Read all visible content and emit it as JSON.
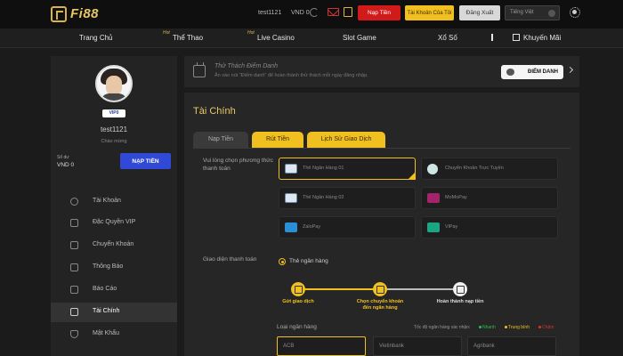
{
  "header": {
    "logo": "Fi88",
    "username": "test1121",
    "balance": "VND 0",
    "deposit_btn": "Nạp Tiền",
    "account_btn": "Tài Khoản Của Tôi",
    "logout_btn": "Đăng Xuất",
    "language": "Tiếng Việt",
    "lang_flag": "VN"
  },
  "nav": {
    "hot": "Hot",
    "items": [
      "Trang Chủ",
      "Thể Thao",
      "Live Casino",
      "Slot Game",
      "Xổ Số",
      "Khuyến Mãi"
    ]
  },
  "sidebar": {
    "vip": "VIP0",
    "username": "test1121",
    "welcome": "Chào mừng",
    "balance_label": "Số dư",
    "balance_value": "VND 0",
    "deposit_btn": "NẠP TIỀN",
    "items": [
      "Tài Khoản",
      "Đặc Quyền VIP",
      "Chuyển Khoản",
      "Thông Báo",
      "Báo Cáo",
      "Tài Chính",
      "Mật Khẩu"
    ],
    "active_index": 5
  },
  "challenge": {
    "title": "Thử Thách Điểm Danh",
    "subtitle": "Ấn vào nút \"Điểm danh\" để hoàn thành thử thách mỗi ngày đăng nhập.",
    "button": "ĐIỂM DANH"
  },
  "finance": {
    "title": "Tài Chính",
    "tabs": [
      "Nạp Tiền",
      "Rút Tiền",
      "Lịch Sử Giao Dịch"
    ],
    "method_label": "Vui lòng chọn phương thức thanh toán",
    "methods": [
      "Thẻ Ngân Hàng 01",
      "Chuyển Khoản Trực Tuyến",
      "Thẻ Ngân Hàng 02",
      "MoMoPay",
      "ZaloPay",
      "ViPay"
    ],
    "selected_method": 0,
    "interface_label": "Giao diện thanh toán",
    "interface_option": "Thẻ ngân hàng",
    "steps": [
      "Gửi giao dịch",
      "Chọn chuyển khoản đến ngân hàng",
      "Hoàn thành nạp tiền"
    ],
    "bank_label": "Loại ngân hàng",
    "speed_label": "Tốc độ ngân hàng xác nhận:",
    "speeds": [
      {
        "label": "Nhanh",
        "color": "#2bbf4a"
      },
      {
        "label": "Trung bình",
        "color": "#f0c020"
      },
      {
        "label": "Chậm",
        "color": "#e03030"
      }
    ],
    "banks": [
      "ACB",
      "Vietinbank",
      "Agribank"
    ]
  }
}
